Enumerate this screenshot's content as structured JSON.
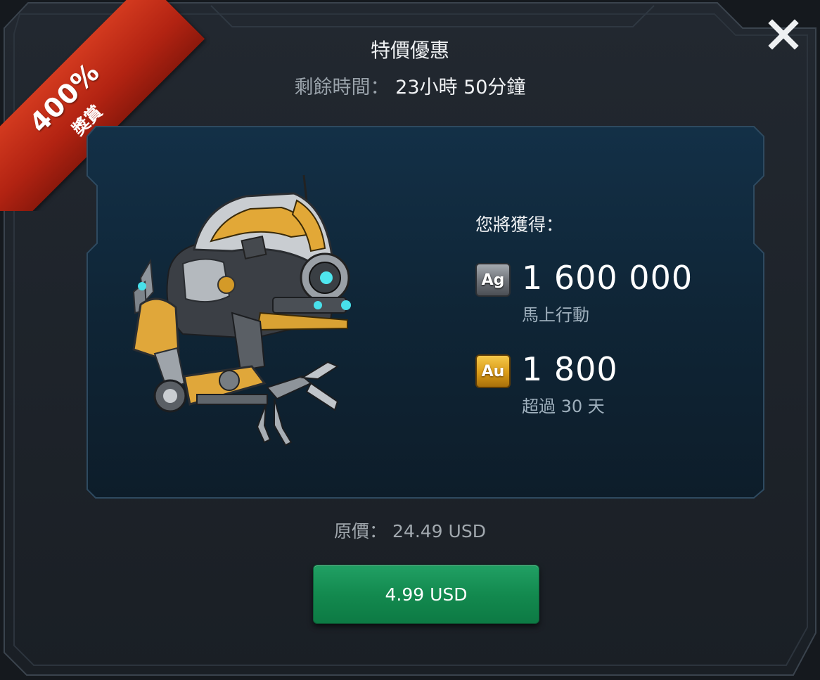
{
  "badge": {
    "percent": "400%",
    "label": "獎賞"
  },
  "close_icon": "close-icon",
  "header": {
    "title": "特價優惠",
    "timer_label": "剩餘時間：",
    "timer_value": "23小時 50分鐘"
  },
  "offer": {
    "gain_label": "您將獲得：",
    "items": [
      {
        "icon_text": "Ag",
        "amount": "1 600 000",
        "note": "馬上行動"
      },
      {
        "icon_text": "Au",
        "amount": "1 800",
        "note": "超過 30 天"
      }
    ]
  },
  "pricing": {
    "original_label": "原價：",
    "original_value": "24.49 USD",
    "buy_label": "4.99 USD"
  },
  "colors": {
    "background": "#15191e",
    "panel": "#0f2536",
    "ribbon": "#c02d16",
    "buy_button": "#138a4f",
    "silver": "#8a8f95",
    "gold": "#e0a420"
  }
}
